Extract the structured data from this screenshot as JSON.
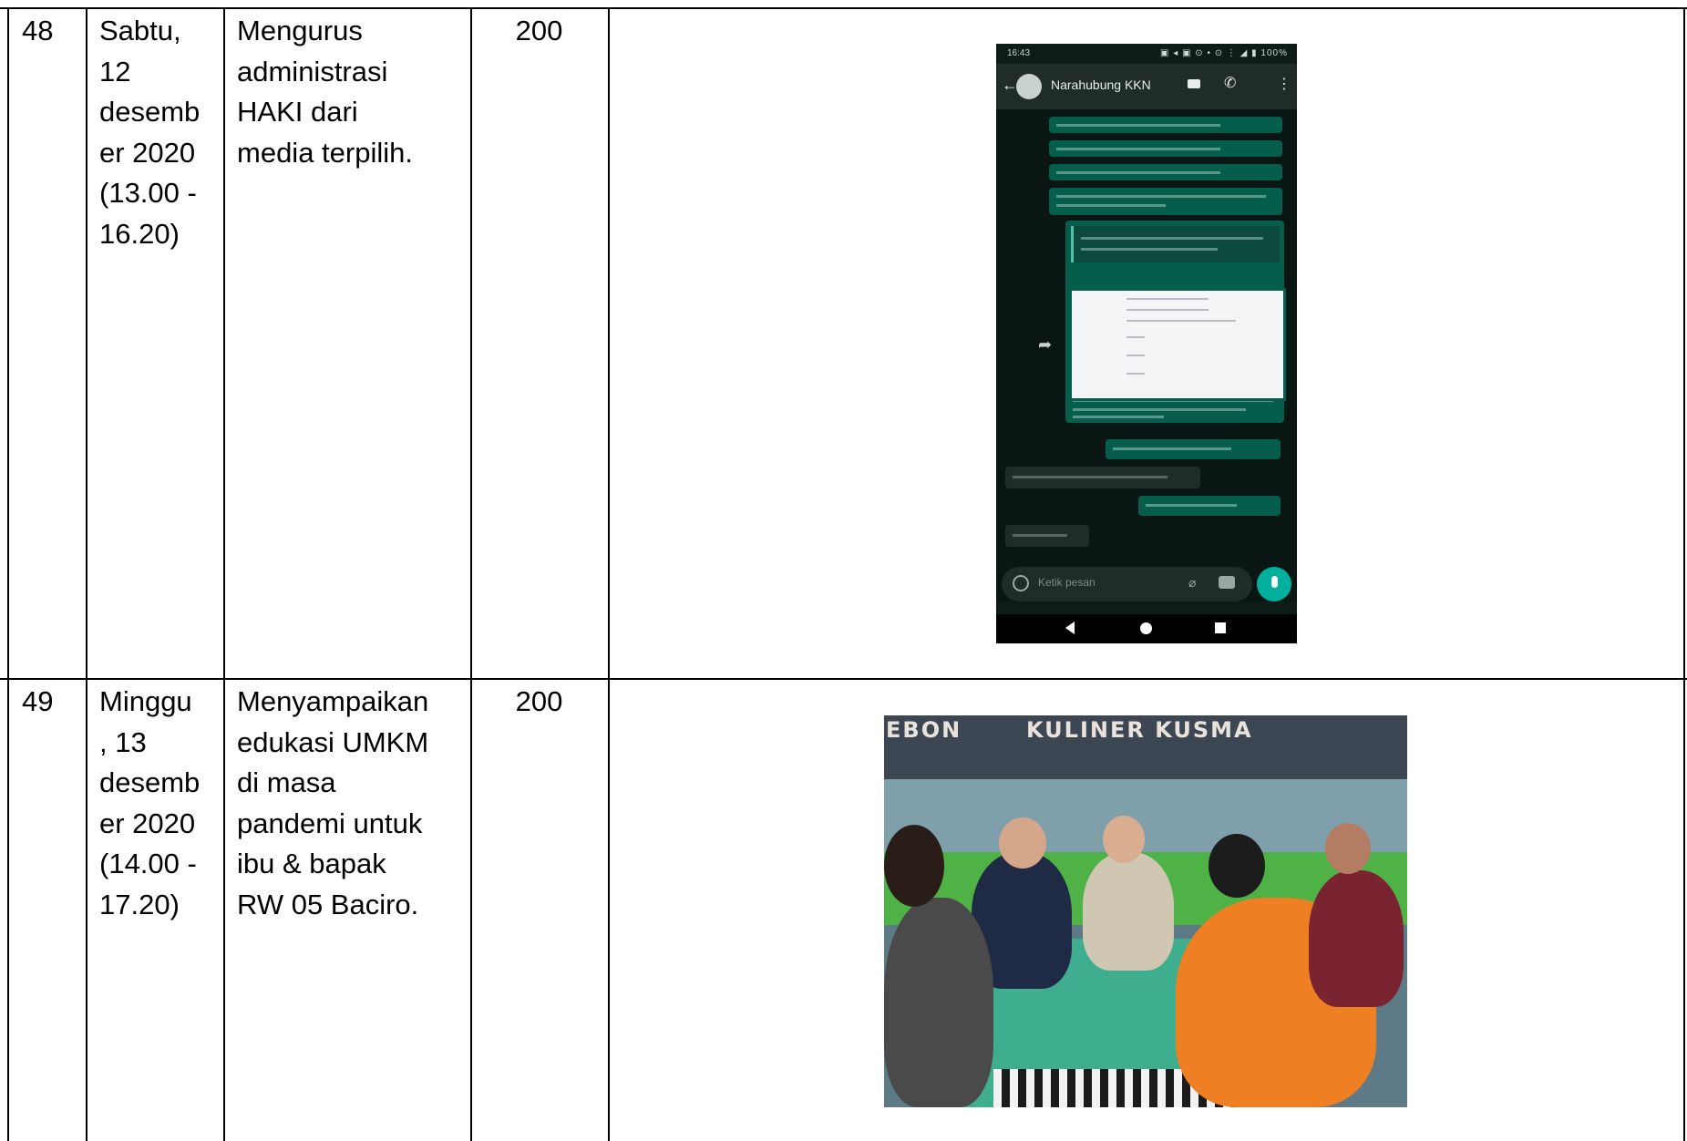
{
  "rows": [
    {
      "no": "48",
      "date": "Sabtu,\n12\ndesemb\ner 2020\n(13.00 -\n16.20)",
      "activity": "Mengurus\nadministrasi\nHAKI dari\nmedia terpilih.",
      "duration": "200",
      "evidence": {
        "type": "whatsapp-screenshot",
        "status_time": "16:43",
        "status_icons": "▣ ◂ ▣ ⊙ •      ⊙ ⋮ ◢ ▮ 100%",
        "chat_name": "Narahubung KKN",
        "input_placeholder": "Ketik pesan"
      }
    },
    {
      "no": "49",
      "date": "Minggu\n, 13\ndesemb\ner 2020\n(14.00 -\n17.20)",
      "activity": "Menyampaikan\nedukasi UMKM\ndi masa\npandemi untuk\nibu & bapak\nRW 05 Baciro.",
      "duration": "200",
      "evidence": {
        "type": "photo",
        "sign_left": "EBON",
        "sign_right": "KULINER KUSMA"
      }
    }
  ],
  "colors": {
    "grid": "#000000",
    "whatsapp_dark": "#0d1b19",
    "bubble_out": "#055d4b",
    "accent_green": "#00af9c"
  }
}
